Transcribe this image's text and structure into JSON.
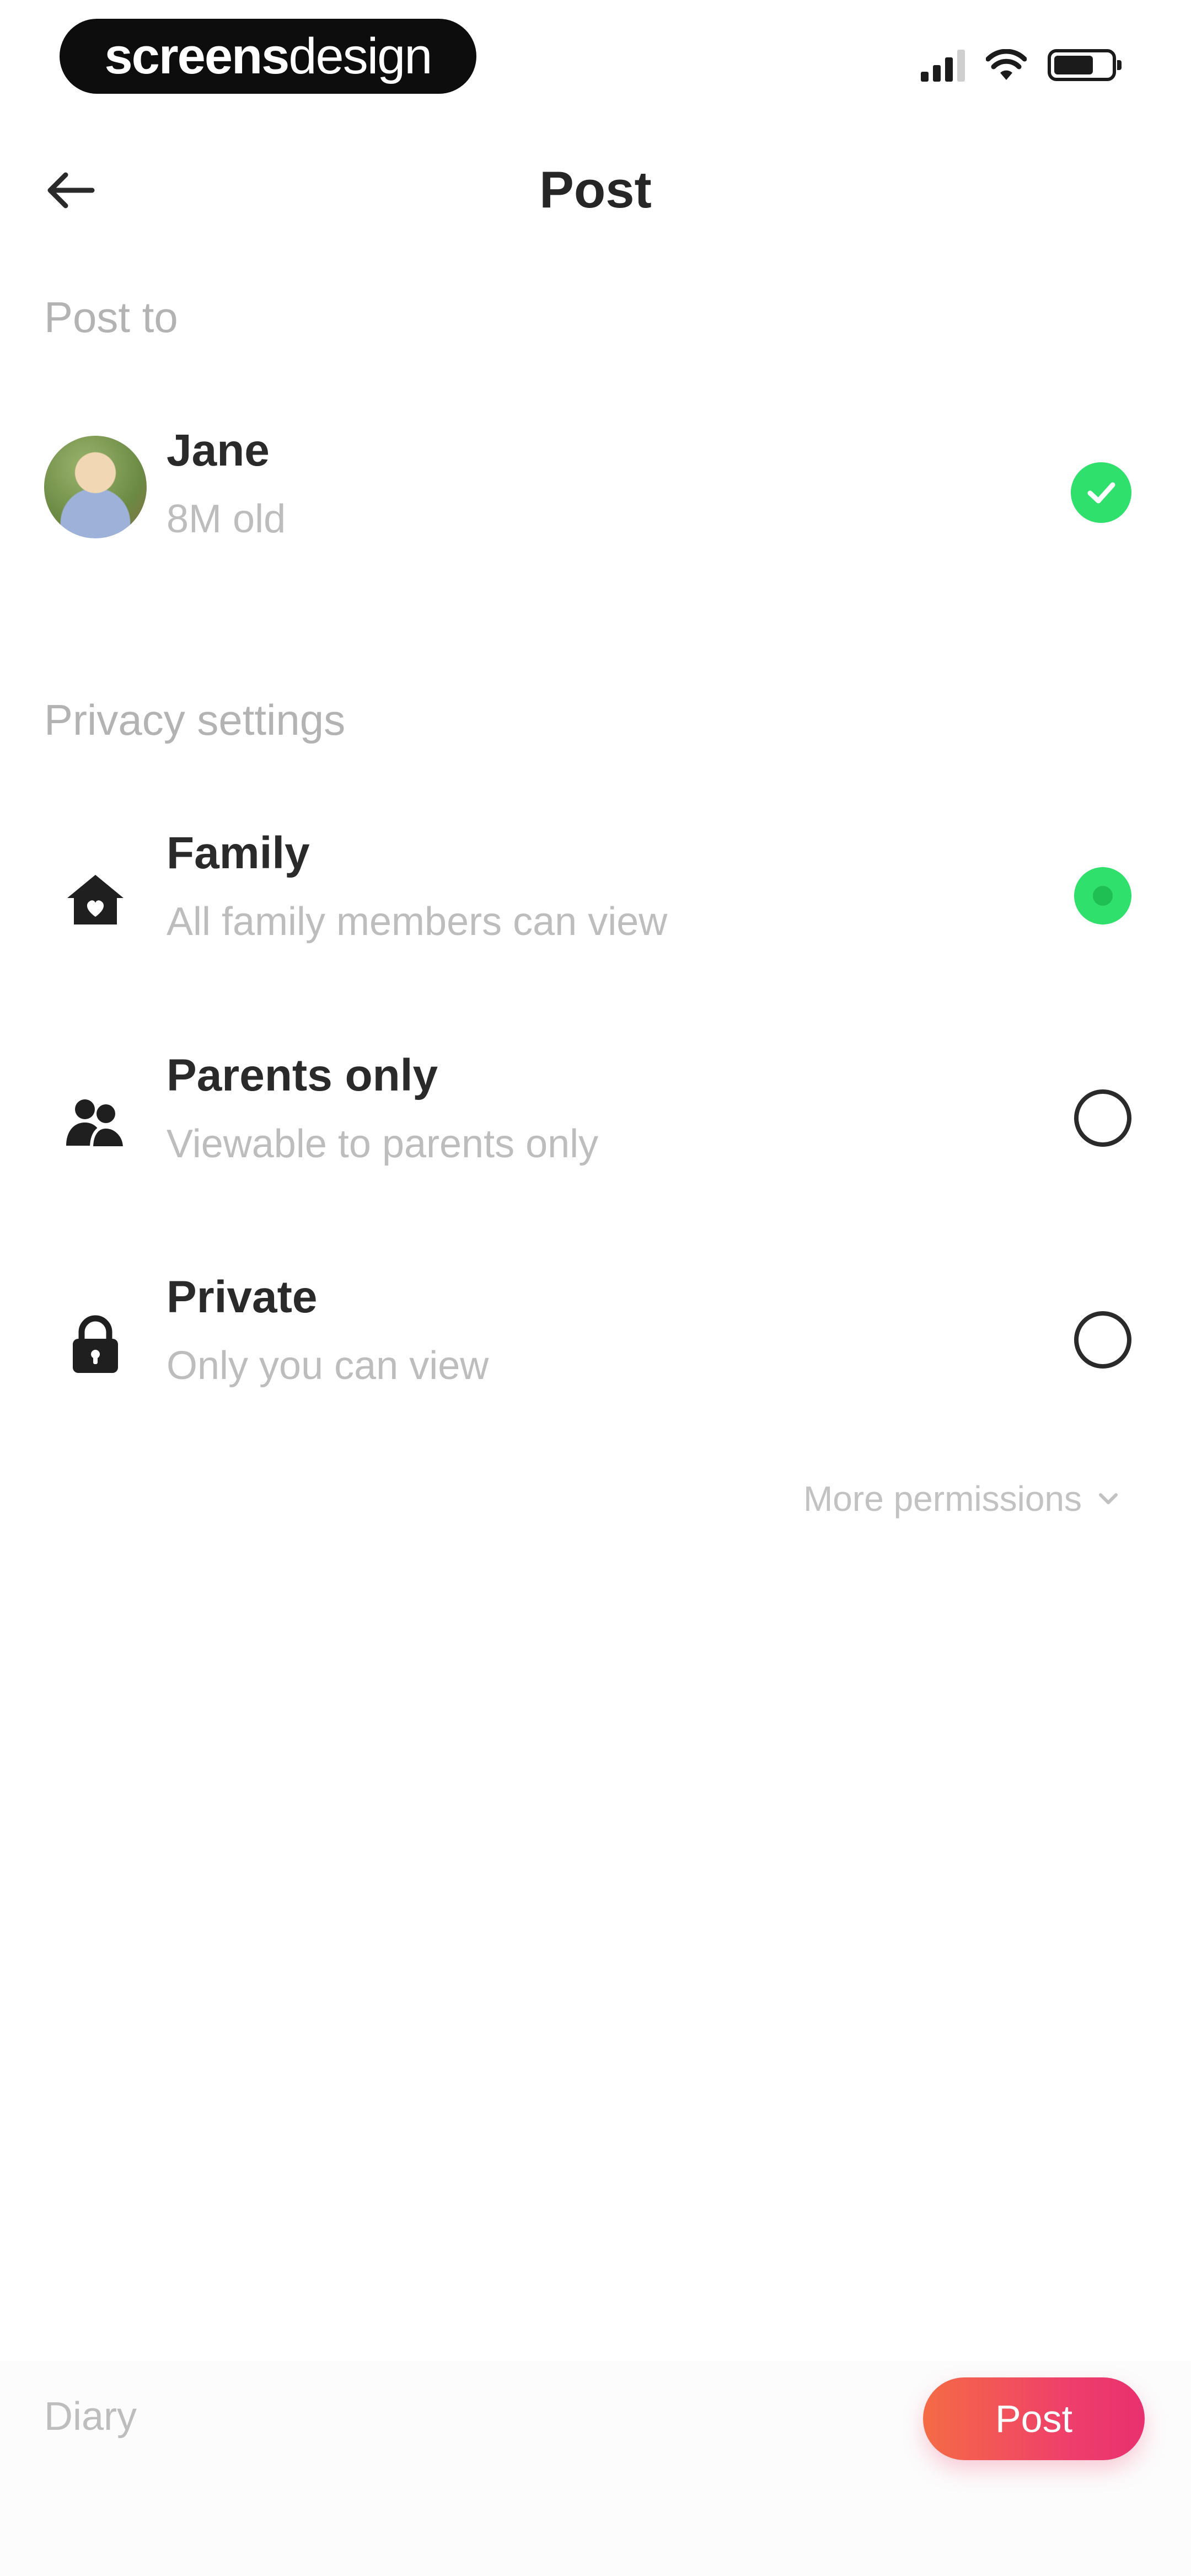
{
  "status_bar": {
    "brand": {
      "part1": "screens",
      "part2": "design"
    }
  },
  "header": {
    "title": "Post"
  },
  "post_to": {
    "label": "Post to",
    "recipient": {
      "name": "Jane",
      "age": "8M old",
      "selected": true
    }
  },
  "privacy": {
    "label": "Privacy settings",
    "options": [
      {
        "title": "Family",
        "subtitle": "All family members can view",
        "icon": "house-icon",
        "selected": true
      },
      {
        "title": "Parents only",
        "subtitle": "Viewable to parents only",
        "icon": "parents-icon",
        "selected": false
      },
      {
        "title": "Private",
        "subtitle": "Only you can view",
        "icon": "lock-icon",
        "selected": false
      }
    ],
    "more_label": "More permissions"
  },
  "footer": {
    "diary": "Diary",
    "post_button": "Post"
  },
  "colors": {
    "accent_green": "#2fe06d",
    "post_gradient_start": "#f56b45",
    "post_gradient_end": "#e8306f"
  }
}
